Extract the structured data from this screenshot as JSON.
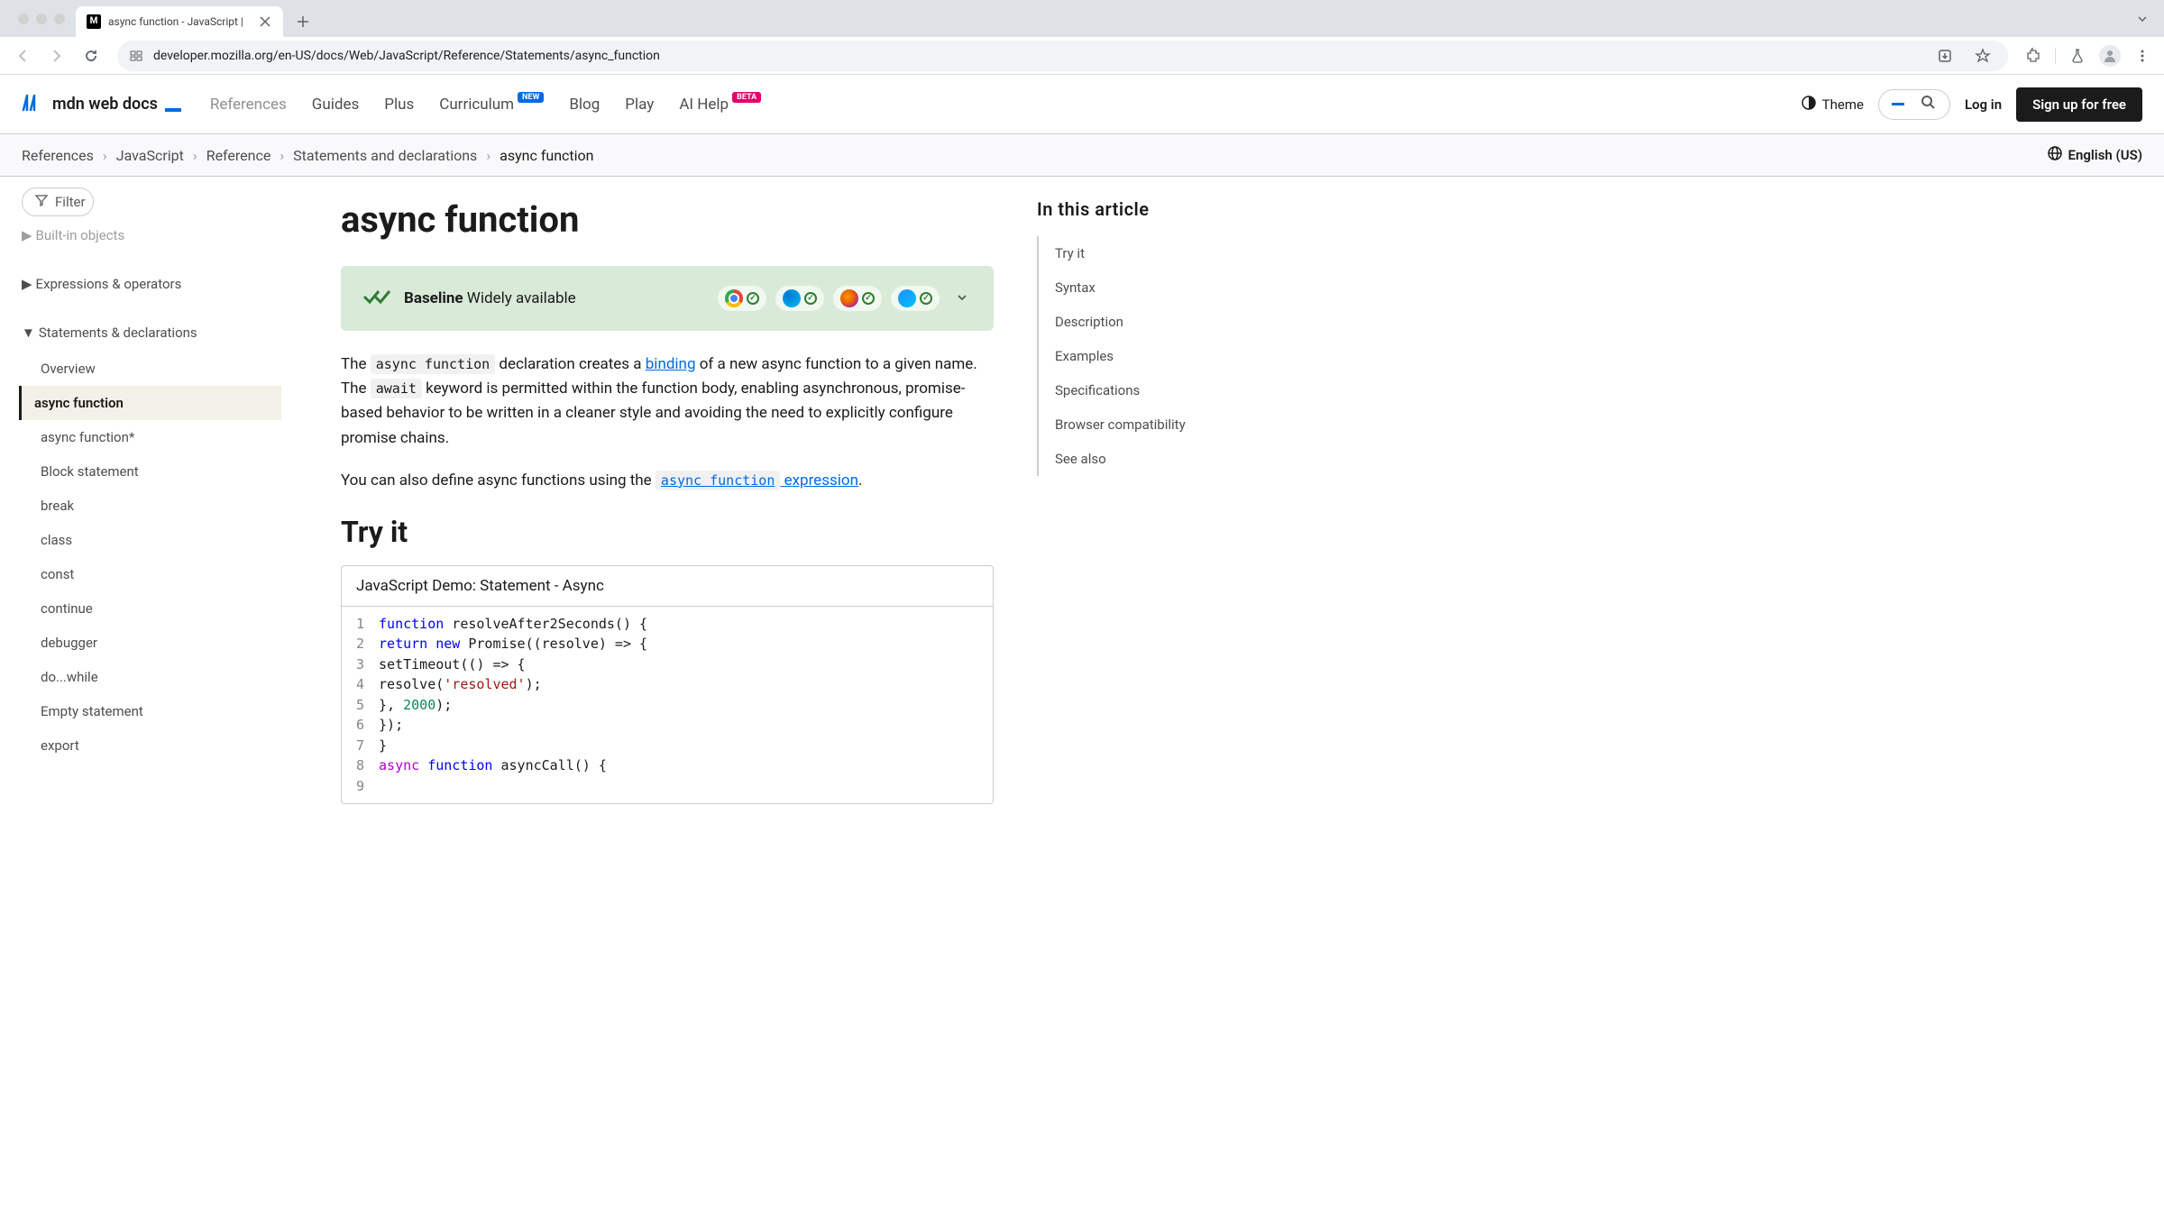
{
  "browser": {
    "tab_title": "async function - JavaScript |",
    "url": "developer.mozilla.org/en-US/docs/Web/JavaScript/Reference/Statements/async_function"
  },
  "header": {
    "logo_text": "mdn web docs",
    "nav": {
      "references": "References",
      "guides": "Guides",
      "plus": "Plus",
      "curriculum": "Curriculum",
      "curriculum_badge": "NEW",
      "blog": "Blog",
      "play": "Play",
      "ai_help": "AI Help",
      "ai_help_badge": "BETA"
    },
    "theme": "Theme",
    "login": "Log in",
    "signup": "Sign up for free"
  },
  "breadcrumbs": {
    "items": [
      "References",
      "JavaScript",
      "Reference",
      "Statements and declarations",
      "async function"
    ],
    "language": "English (US)"
  },
  "sidebar": {
    "filter_label": "Filter",
    "groups": {
      "built_in": "Built-in objects",
      "expressions": "Expressions & operators",
      "statements": "Statements & declarations"
    },
    "items": [
      "Overview",
      "async function",
      "async function*",
      "Block statement",
      "break",
      "class",
      "const",
      "continue",
      "debugger",
      "do...while",
      "Empty statement",
      "export"
    ]
  },
  "content": {
    "title": "async function",
    "baseline_strong": "Baseline",
    "baseline_rest": " Widely available",
    "intro_text_1": "The ",
    "intro_code_1": "async function",
    "intro_text_2": " declaration creates a ",
    "intro_link_1": "binding",
    "intro_text_3": " of a new async function to a given name. The ",
    "intro_code_2": "await",
    "intro_text_4": " keyword is permitted within the function body, enabling asynchronous, promise-based behavior to be written in a cleaner style and avoiding the need to explicitly configure promise chains.",
    "intro2_text_1": "You can also define async functions using the ",
    "intro2_code": "async function",
    "intro2_link": " expression",
    "intro2_text_2": ".",
    "try_it_heading": "Try it",
    "demo_title": "JavaScript Demo: Statement - Async",
    "code": {
      "l1_kw": "function",
      "l1_rest": " resolveAfter2Seconds() {",
      "l2_ret": "return",
      "l2_new": "new",
      "l2_rest": " Promise((resolve) => {",
      "l3": "    setTimeout(() => {",
      "l4_pre": "      resolve(",
      "l4_str": "'resolved'",
      "l4_post": ");",
      "l5_pre": "    }, ",
      "l5_num": "2000",
      "l5_post": ");",
      "l6": "  });",
      "l7": "}",
      "l8": "",
      "l9_async": "async",
      "l9_func": "function",
      "l9_rest": " asyncCall() {"
    }
  },
  "toc": {
    "title": "In this article",
    "items": [
      "Try it",
      "Syntax",
      "Description",
      "Examples",
      "Specifications",
      "Browser compatibility",
      "See also"
    ]
  }
}
